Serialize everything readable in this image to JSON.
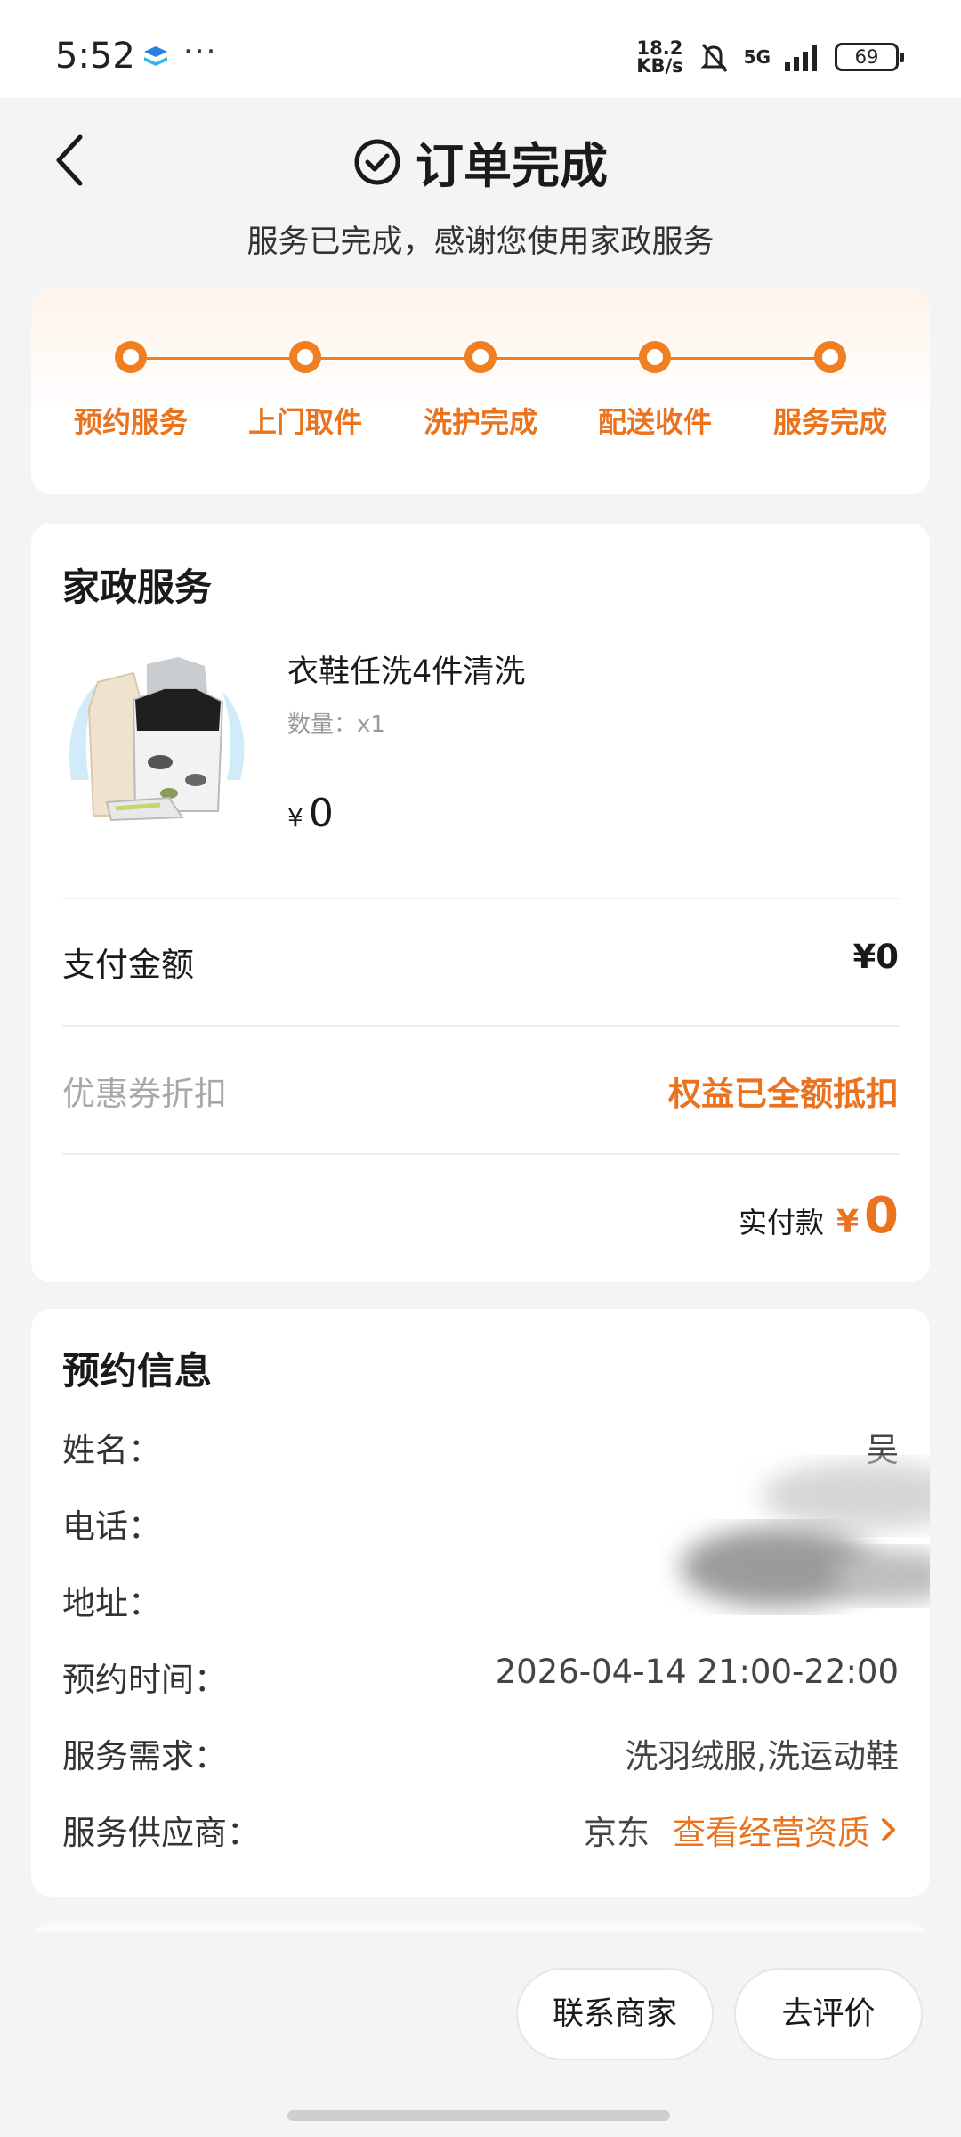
{
  "status_bar": {
    "time": "5:52",
    "more": "···",
    "net_speed_value": "18.2",
    "net_speed_unit": "KB/s",
    "signal": "5G",
    "battery": "69"
  },
  "header": {
    "title": "订单完成",
    "subtitle": "服务已完成，感谢您使用家政服务"
  },
  "progress": {
    "steps": [
      "预约服务",
      "上门取件",
      "洗护完成",
      "配送收件",
      "服务完成"
    ],
    "color": "#f07f22"
  },
  "service": {
    "section_title": "家政服务",
    "product_name": "衣鞋任洗4件清洗",
    "quantity": "数量：x1",
    "price_currency": "¥",
    "price_value": "0",
    "pay_label": "支付金额",
    "pay_value": "¥0",
    "coupon_label": "优惠券折扣",
    "coupon_value": "权益已全额抵扣",
    "paid_label": "实付款",
    "paid_currency": "¥",
    "paid_value": "0"
  },
  "booking": {
    "section_title": "预约信息",
    "name_label": "姓名：",
    "name_value": "吴",
    "phone_label": "电话：",
    "address_label": "地址：",
    "time_label": "预约时间：",
    "time_value": "2026-04-14 21:00-22:00",
    "demand_label": "服务需求：",
    "demand_value": "洗羽绒服,洗运动鞋",
    "provider_label": "服务供应商：",
    "provider_value": "京东",
    "provider_link": "查看经营资质"
  },
  "actions": {
    "contact": "联系商家",
    "review": "去评价"
  },
  "colors": {
    "accent": "#ea7320",
    "background": "#f4f4f4"
  }
}
